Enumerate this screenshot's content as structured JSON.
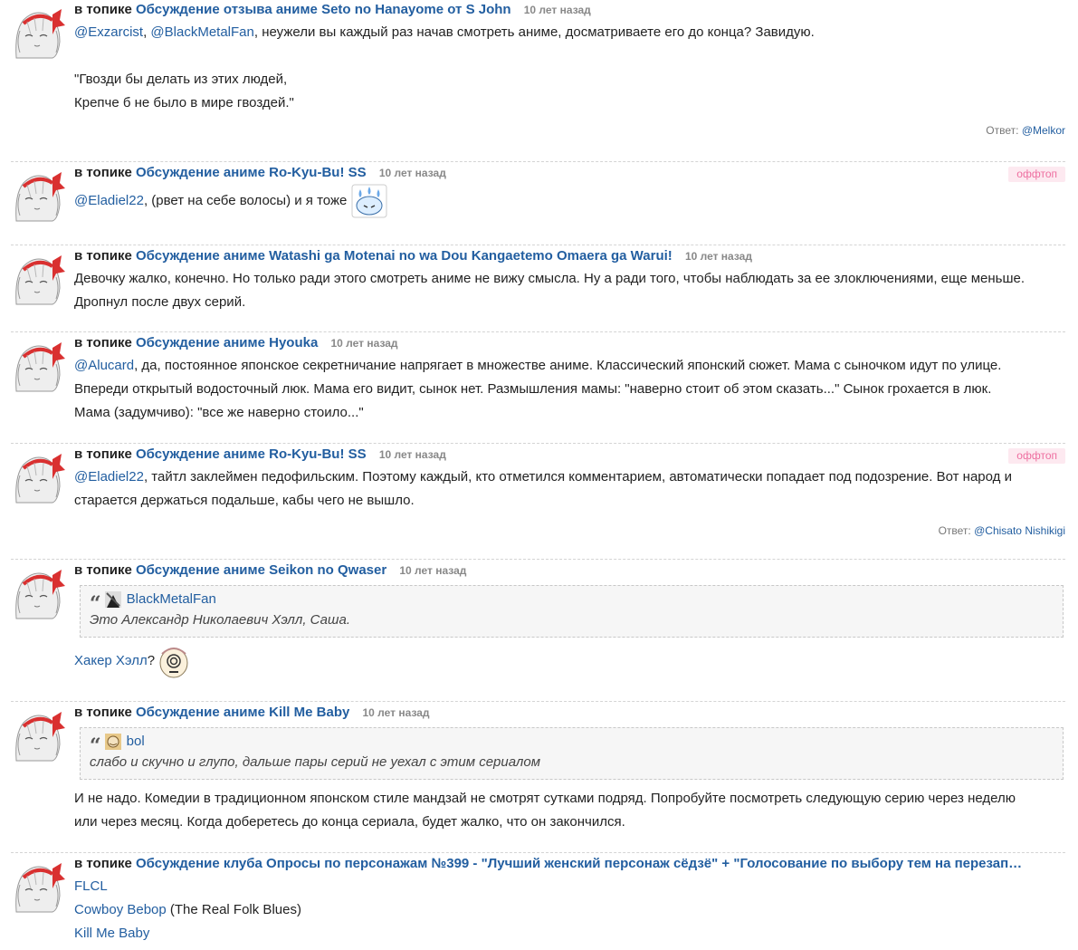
{
  "comments": [
    {
      "in_topic": "в топике",
      "topic": "Обсуждение отзыва аниме Seto no Hanayome от S John",
      "time": "10 лет назад",
      "mention1": "@Exzarcist",
      "sep": ", ",
      "mention2": "@BlackMetalFan",
      "text": ", неужели вы каждый раз начав смотреть аниме, досматриваете его до конца? Завидую.",
      "poem1": "\"Гвозди бы делать из этих людей,",
      "poem2": "Крепче б не было в мире гвоздей.\"",
      "reply_label": "Ответ:",
      "reply_user": "@Melkor"
    },
    {
      "in_topic": "в топике",
      "topic": "Обсуждение аниме Ro-Kyu-Bu! SS",
      "time": "10 лет назад",
      "offtop": "оффтоп",
      "mention": "@Eladiel22",
      "text": ", (рвет на себе волосы) и я тоже",
      "emoji": "crying-emoji"
    },
    {
      "in_topic": "в топике",
      "topic": "Обсуждение аниме Watashi ga Motenai no wa Dou Kangaetemo Omaera ga Warui!",
      "time": "10 лет назад",
      "text1": "Девочку жалко, конечно. Но только ради этого смотреть аниме не вижу смысла. Ну а ради того, чтобы наблюдать за ее злоключениями, еще меньше.",
      "text2": "Дропнул после двух серий."
    },
    {
      "in_topic": "в топике",
      "topic": "Обсуждение аниме Hyouka",
      "time": "10 лет назад",
      "mention": "@Alucard",
      "text1": ", да, постоянное японское секретничание напрягает в множестве аниме. Классический японский сюжет. Мама с сыночком идут по улице.",
      "text2": "Впереди открытый водосточный люк. Мама его видит, сынок нет. Размышления мамы: \"наверно стоит об этом сказать...\" Сынок грохается в люк.",
      "text3": "Мама (задумчиво): \"все же наверно стоило...\""
    },
    {
      "in_topic": "в топике",
      "topic": "Обсуждение аниме Ro-Kyu-Bu! SS",
      "time": "10 лет назад",
      "offtop": "оффтоп",
      "mention": "@Eladiel22",
      "text1": ", тайтл заклеймен педофильским. Поэтому каждый, кто отметился комментарием, автоматически попадает под подозрение. Вот народ и",
      "text2": "старается держаться подальше, кабы чего не вышло.",
      "reply_label": "Ответ:",
      "reply_user": "@Chisato Nishikigi"
    },
    {
      "in_topic": "в топике",
      "topic": "Обсуждение аниме Seikon no Qwaser",
      "time": "10 лет назад",
      "quote_user": "BlackMetalFan",
      "quote_text": "Это Александр Николаевич Хэлл, Саша.",
      "link": "Хакер Хэлл",
      "text": "?",
      "emoji": "dizzy-emoji"
    },
    {
      "in_topic": "в топике",
      "topic": "Обсуждение аниме Kill Me Baby",
      "time": "10 лет назад",
      "quote_user": "bol",
      "quote_text": "слабо и скучно и глупо, дальше пары серий не уехал с этим сериалом",
      "text1": "И не надо. Комедии в традиционном японском стиле мандзай не смотрят сутками подряд. Попробуйте посмотреть следующую серию через неделю",
      "text2": "или через месяц. Когда доберетесь до конца сериала, будет жалко, что он закончился."
    },
    {
      "in_topic": "в топике",
      "topic": "Обсуждение клуба Опросы по персонажам №399 - \"Лучший женский персонаж сёдзё\" + \"Голосование по выбору тем на перезап…",
      "link1": "FLCL",
      "link2": "Cowboy Bebop",
      "text2": " (The Real Folk Blues)",
      "link3": "Kill Me Baby"
    }
  ],
  "colors": {
    "link": "#225ea0",
    "offtop_text": "#ee6fa0",
    "offtop_bg": "#fde9f0",
    "time": "#888888"
  }
}
